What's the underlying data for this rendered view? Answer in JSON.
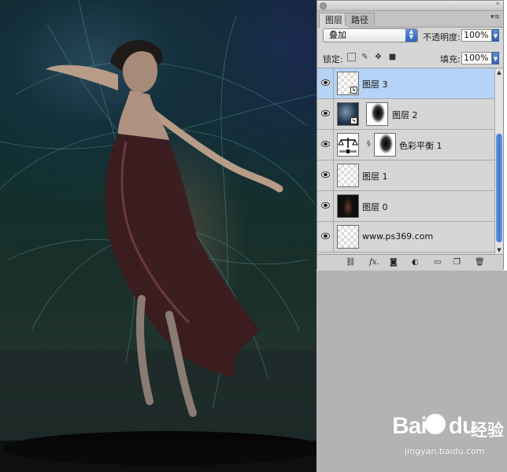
{
  "panel": {
    "tabs": [
      {
        "label": "图层"
      },
      {
        "label": "路径"
      }
    ],
    "blend_mode": "叠加",
    "opacity_label": "不透明度:",
    "opacity_value": "100%",
    "lock_label": "锁定:",
    "fill_label": "填充:",
    "fill_value": "100%",
    "layers": [
      {
        "name": "图层 3",
        "selected": true
      },
      {
        "name": "图层 2",
        "selected": false
      },
      {
        "name": "色彩平衡 1",
        "selected": false
      },
      {
        "name": "图层 1",
        "selected": false
      },
      {
        "name": "图层 0",
        "selected": false
      },
      {
        "name": "www.ps369.com",
        "selected": false
      }
    ],
    "bottom_icons": [
      "link-icon",
      "fx-icon",
      "add-mask-icon",
      "adjustment-icon",
      "group-folder-icon",
      "new-layer-icon",
      "trash-icon"
    ],
    "fx_label": "fx."
  },
  "watermark": {
    "logo": "Bai",
    "logo2": "du",
    "cn": "经验",
    "url": "jingyan.baidu.com"
  }
}
